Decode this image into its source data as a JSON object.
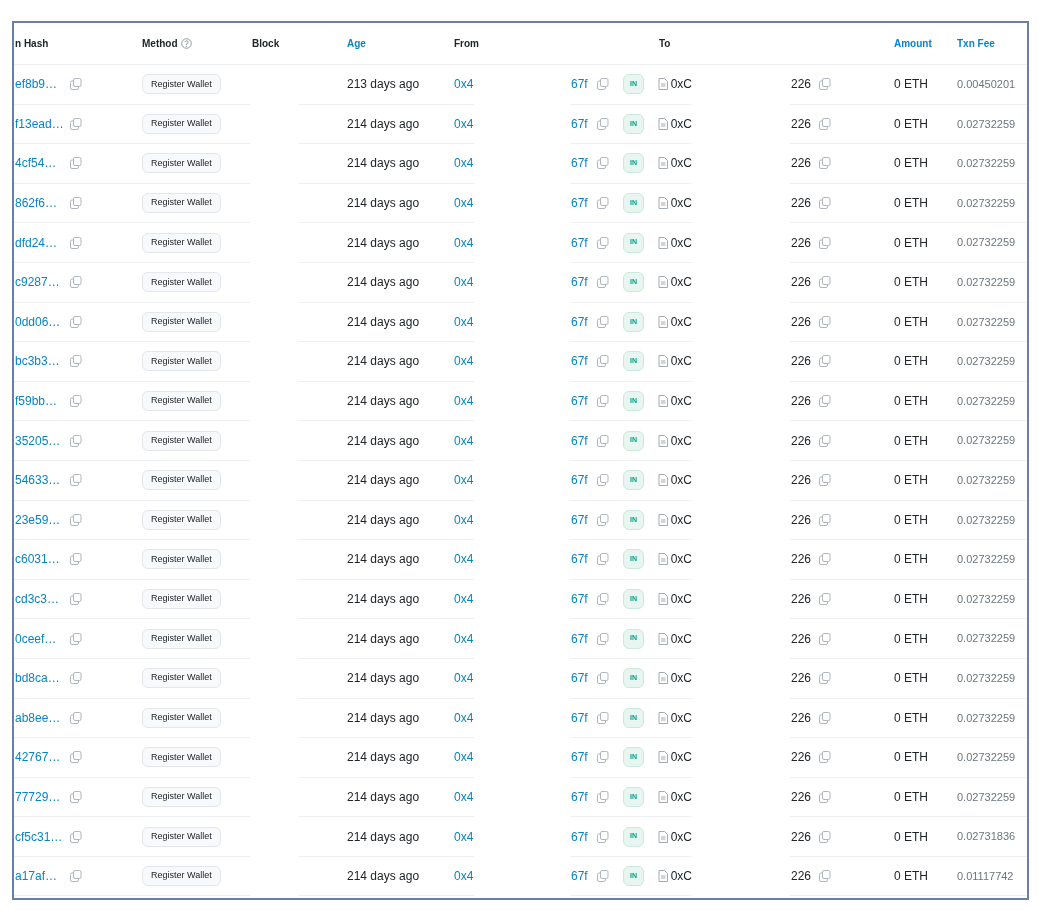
{
  "columns": [
    {
      "label": "n Hash",
      "kind": "plain"
    },
    {
      "label": "Method",
      "kind": "help"
    },
    {
      "label": "Block",
      "kind": "plain"
    },
    {
      "label": "Age",
      "kind": "link"
    },
    {
      "label": "From",
      "kind": "plain"
    },
    {
      "label": "To",
      "kind": "plain"
    },
    {
      "label": "Amount",
      "kind": "link"
    },
    {
      "label": "Txn Fee",
      "kind": "link"
    }
  ],
  "rows": [
    {
      "hash": "ef8b9…",
      "method": "Register Wallet",
      "age": "213 days ago",
      "from_start": "0x4",
      "from_end": "67f",
      "direction": "IN",
      "to_start": "0xC",
      "to_end": "226",
      "amount": "0 ETH",
      "fee": "0.00450201"
    },
    {
      "hash": "f13ead…",
      "method": "Register Wallet",
      "age": "214 days ago",
      "from_start": "0x4",
      "from_end": "67f",
      "direction": "IN",
      "to_start": "0xC",
      "to_end": "226",
      "amount": "0 ETH",
      "fee": "0.02732259"
    },
    {
      "hash": "4cf54…",
      "method": "Register Wallet",
      "age": "214 days ago",
      "from_start": "0x4",
      "from_end": "67f",
      "direction": "IN",
      "to_start": "0xC",
      "to_end": "226",
      "amount": "0 ETH",
      "fee": "0.02732259"
    },
    {
      "hash": "862f6…",
      "method": "Register Wallet",
      "age": "214 days ago",
      "from_start": "0x4",
      "from_end": "67f",
      "direction": "IN",
      "to_start": "0xC",
      "to_end": "226",
      "amount": "0 ETH",
      "fee": "0.02732259"
    },
    {
      "hash": "dfd24…",
      "method": "Register Wallet",
      "age": "214 days ago",
      "from_start": "0x4",
      "from_end": "67f",
      "direction": "IN",
      "to_start": "0xC",
      "to_end": "226",
      "amount": "0 ETH",
      "fee": "0.02732259"
    },
    {
      "hash": "c9287…",
      "method": "Register Wallet",
      "age": "214 days ago",
      "from_start": "0x4",
      "from_end": "67f",
      "direction": "IN",
      "to_start": "0xC",
      "to_end": "226",
      "amount": "0 ETH",
      "fee": "0.02732259"
    },
    {
      "hash": "0dd06…",
      "method": "Register Wallet",
      "age": "214 days ago",
      "from_start": "0x4",
      "from_end": "67f",
      "direction": "IN",
      "to_start": "0xC",
      "to_end": "226",
      "amount": "0 ETH",
      "fee": "0.02732259"
    },
    {
      "hash": "bc3b3…",
      "method": "Register Wallet",
      "age": "214 days ago",
      "from_start": "0x4",
      "from_end": "67f",
      "direction": "IN",
      "to_start": "0xC",
      "to_end": "226",
      "amount": "0 ETH",
      "fee": "0.02732259"
    },
    {
      "hash": "f59bb…",
      "method": "Register Wallet",
      "age": "214 days ago",
      "from_start": "0x4",
      "from_end": "67f",
      "direction": "IN",
      "to_start": "0xC",
      "to_end": "226",
      "amount": "0 ETH",
      "fee": "0.02732259"
    },
    {
      "hash": "35205…",
      "method": "Register Wallet",
      "age": "214 days ago",
      "from_start": "0x4",
      "from_end": "67f",
      "direction": "IN",
      "to_start": "0xC",
      "to_end": "226",
      "amount": "0 ETH",
      "fee": "0.02732259"
    },
    {
      "hash": "54633…",
      "method": "Register Wallet",
      "age": "214 days ago",
      "from_start": "0x4",
      "from_end": "67f",
      "direction": "IN",
      "to_start": "0xC",
      "to_end": "226",
      "amount": "0 ETH",
      "fee": "0.02732259"
    },
    {
      "hash": "23e59…",
      "method": "Register Wallet",
      "age": "214 days ago",
      "from_start": "0x4",
      "from_end": "67f",
      "direction": "IN",
      "to_start": "0xC",
      "to_end": "226",
      "amount": "0 ETH",
      "fee": "0.02732259"
    },
    {
      "hash": "c6031…",
      "method": "Register Wallet",
      "age": "214 days ago",
      "from_start": "0x4",
      "from_end": "67f",
      "direction": "IN",
      "to_start": "0xC",
      "to_end": "226",
      "amount": "0 ETH",
      "fee": "0.02732259"
    },
    {
      "hash": "cd3c3…",
      "method": "Register Wallet",
      "age": "214 days ago",
      "from_start": "0x4",
      "from_end": "67f",
      "direction": "IN",
      "to_start": "0xC",
      "to_end": "226",
      "amount": "0 ETH",
      "fee": "0.02732259"
    },
    {
      "hash": "0ceef…",
      "method": "Register Wallet",
      "age": "214 days ago",
      "from_start": "0x4",
      "from_end": "67f",
      "direction": "IN",
      "to_start": "0xC",
      "to_end": "226",
      "amount": "0 ETH",
      "fee": "0.02732259"
    },
    {
      "hash": "bd8ca…",
      "method": "Register Wallet",
      "age": "214 days ago",
      "from_start": "0x4",
      "from_end": "67f",
      "direction": "IN",
      "to_start": "0xC",
      "to_end": "226",
      "amount": "0 ETH",
      "fee": "0.02732259"
    },
    {
      "hash": "ab8ee…",
      "method": "Register Wallet",
      "age": "214 days ago",
      "from_start": "0x4",
      "from_end": "67f",
      "direction": "IN",
      "to_start": "0xC",
      "to_end": "226",
      "amount": "0 ETH",
      "fee": "0.02732259"
    },
    {
      "hash": "42767…",
      "method": "Register Wallet",
      "age": "214 days ago",
      "from_start": "0x4",
      "from_end": "67f",
      "direction": "IN",
      "to_start": "0xC",
      "to_end": "226",
      "amount": "0 ETH",
      "fee": "0.02732259"
    },
    {
      "hash": "77729…",
      "method": "Register Wallet",
      "age": "214 days ago",
      "from_start": "0x4",
      "from_end": "67f",
      "direction": "IN",
      "to_start": "0xC",
      "to_end": "226",
      "amount": "0 ETH",
      "fee": "0.02732259"
    },
    {
      "hash": "cf5c31…",
      "method": "Register Wallet",
      "age": "214 days ago",
      "from_start": "0x4",
      "from_end": "67f",
      "direction": "IN",
      "to_start": "0xC",
      "to_end": "226",
      "amount": "0 ETH",
      "fee": "0.02731836"
    },
    {
      "hash": "a17af…",
      "method": "Register Wallet",
      "age": "214 days ago",
      "from_start": "0x4",
      "from_end": "67f",
      "direction": "IN",
      "to_start": "0xC",
      "to_end": "226",
      "amount": "0 ETH",
      "fee": "0.01117742"
    }
  ]
}
